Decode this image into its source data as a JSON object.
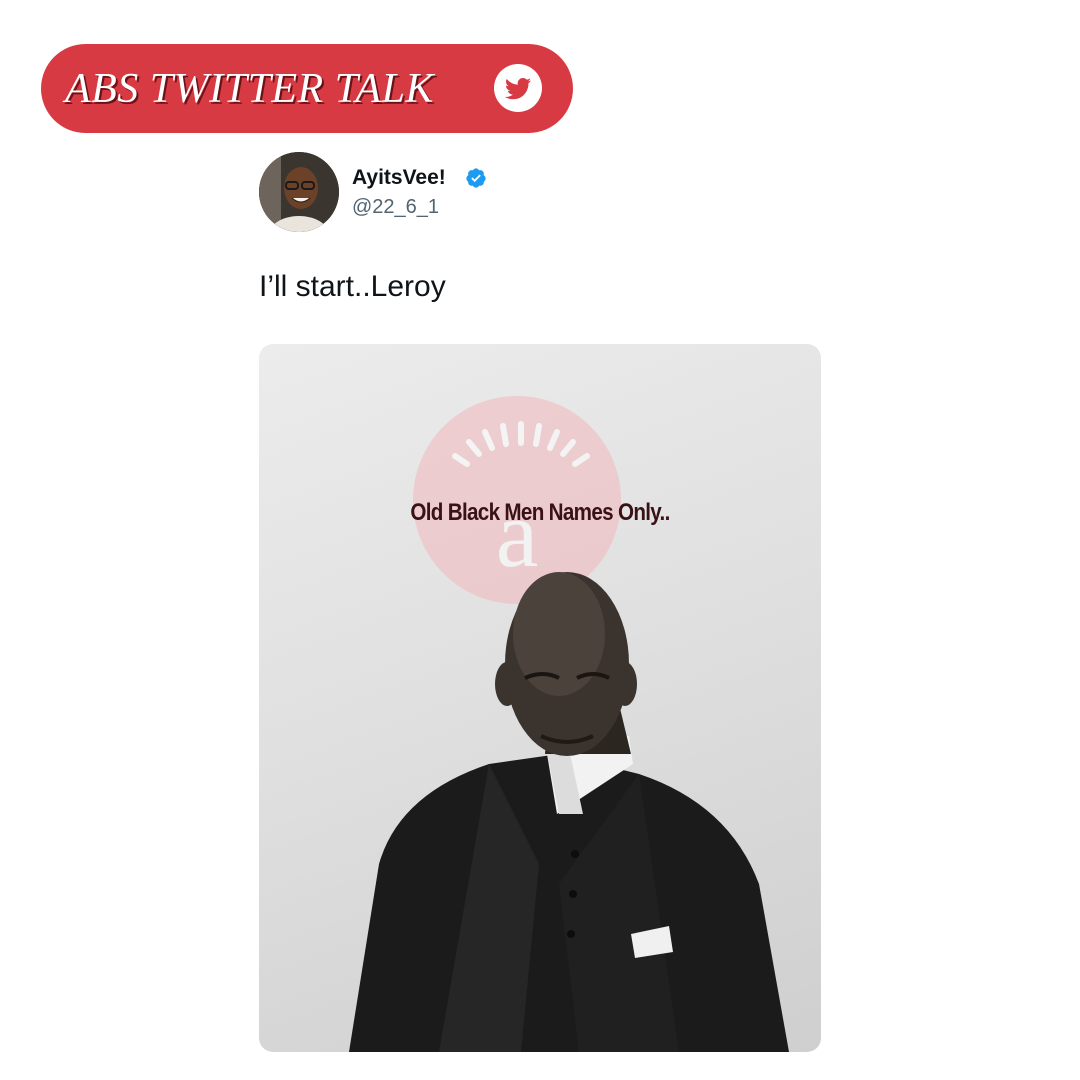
{
  "banner": {
    "title": "ABS TWITTER TALK",
    "icon": "twitter-bird-icon",
    "color": "#d83a44"
  },
  "tweet": {
    "display_name": "AyitsVee!",
    "handle": "@22_6_1",
    "verified": true,
    "verified_color": "#1d9bf0",
    "text": "I’ll start..Leroy",
    "media": {
      "caption": "Old Black Men Names Only..",
      "watermark_icon": "sunburst-a-logo-icon"
    }
  }
}
